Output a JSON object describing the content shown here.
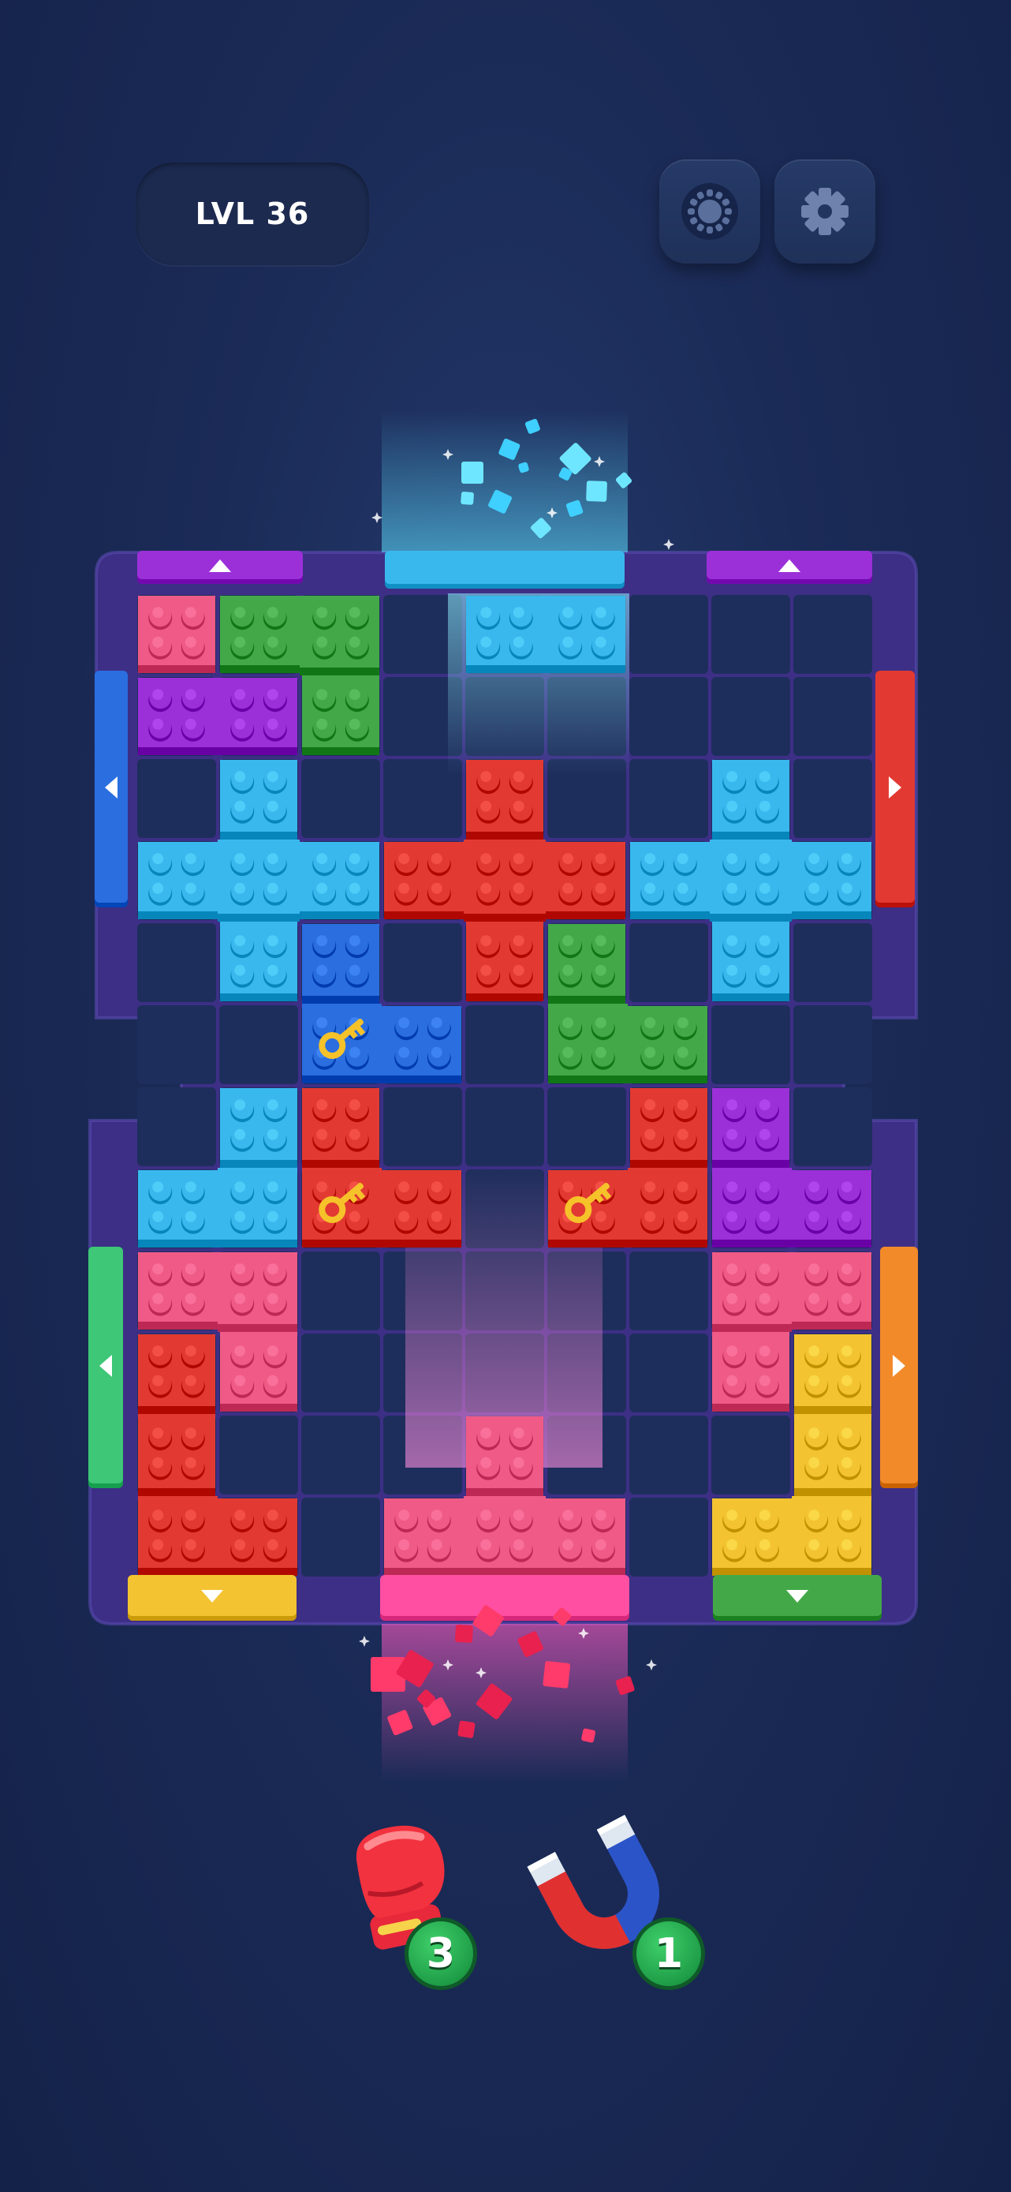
{
  "header": {
    "level_label": "LVL 36",
    "theme_icon": "sun-theme-icon",
    "settings_icon": "gear-icon"
  },
  "board": {
    "grid_columns": 9,
    "grid_rows": 12,
    "keys_visible": 3,
    "colors": {
      "cyan": "#39b8ee",
      "red": "#e23a32",
      "green": "#43a948",
      "purple": "#9b30d8",
      "pink": "#ef5b86",
      "blue": "#2a6ee0",
      "yellow": "#f3c332",
      "orange": "#f28a2a",
      "mint": "#3dc776",
      "magenta": "#ff4fa3",
      "frame": "#3d2f86"
    },
    "gates": [
      {
        "side": "top",
        "color": "purple",
        "arrow": "up"
      },
      {
        "side": "top",
        "color": "cyan",
        "arrow": "none"
      },
      {
        "side": "top",
        "color": "purple",
        "arrow": "up"
      },
      {
        "side": "left",
        "color": "blue",
        "arrow": "left"
      },
      {
        "side": "right",
        "color": "red",
        "arrow": "right"
      },
      {
        "side": "left",
        "color": "mint",
        "arrow": "left"
      },
      {
        "side": "right",
        "color": "orange",
        "arrow": "right"
      },
      {
        "side": "bottom",
        "color": "yellow",
        "arrow": "down"
      },
      {
        "side": "bottom",
        "color": "magenta",
        "arrow": "none"
      },
      {
        "side": "bottom",
        "color": "green",
        "arrow": "down"
      }
    ]
  },
  "boosters": [
    {
      "name": "boxing-glove",
      "count": "3"
    },
    {
      "name": "magnet",
      "count": "1"
    }
  ]
}
